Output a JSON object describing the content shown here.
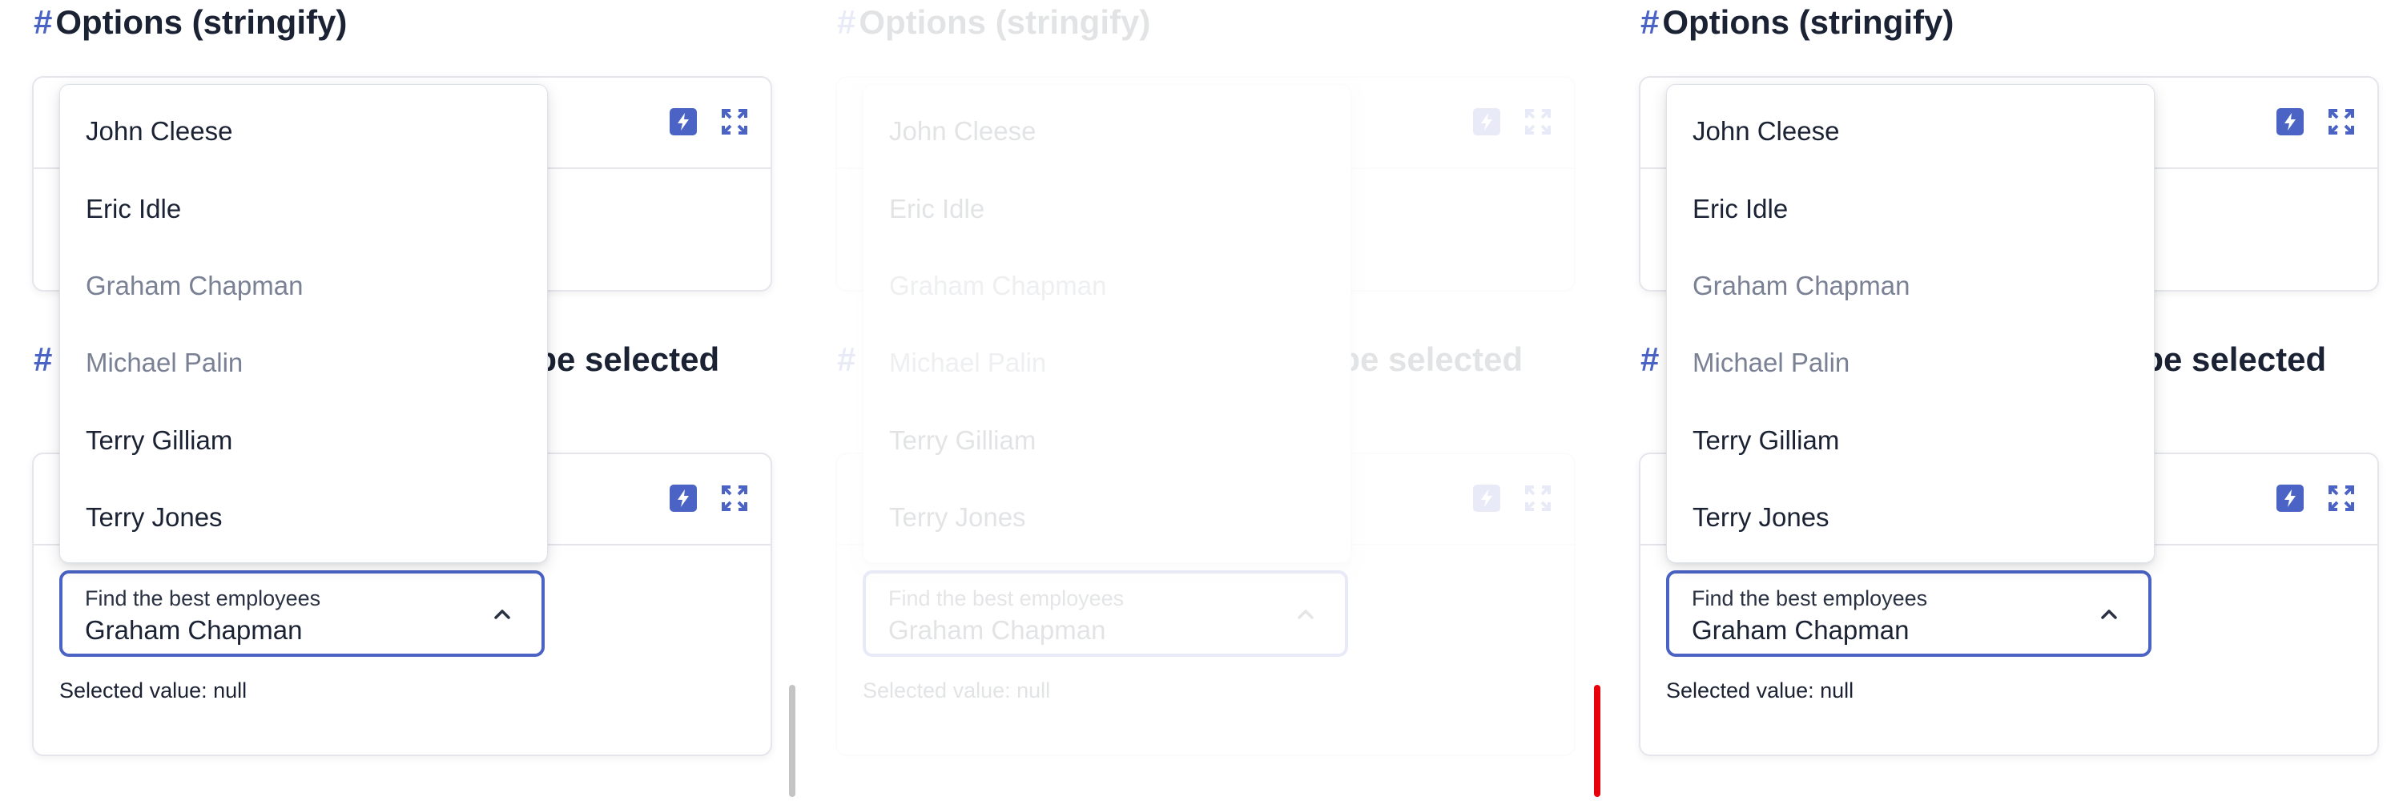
{
  "section1": {
    "hash": "#",
    "title": "Options (stringify)"
  },
  "section2": {
    "hash": "#",
    "title_tail": "o be selected"
  },
  "select": {
    "label": "Find the best employees",
    "value": "Graham Chapman",
    "selected_text": "Selected value: null"
  },
  "options": [
    {
      "label": "John Cleese",
      "disabled": false
    },
    {
      "label": "Eric Idle",
      "disabled": false
    },
    {
      "label": "Graham Chapman",
      "disabled": true
    },
    {
      "label": "Michael Palin",
      "disabled": true
    },
    {
      "label": "Terry Gilliam",
      "disabled": false
    },
    {
      "label": "Terry Jones",
      "disabled": false
    }
  ],
  "icons": {
    "flash": "flash-icon",
    "expand": "expand-icon",
    "chevron": "chevron-up-icon"
  },
  "colors": {
    "accent": "#4a63c4",
    "text": "#1a2233",
    "disabled": "#7a8194",
    "scrollbar": "#c4c4c4",
    "scrollbar_active": "#e8000a"
  }
}
